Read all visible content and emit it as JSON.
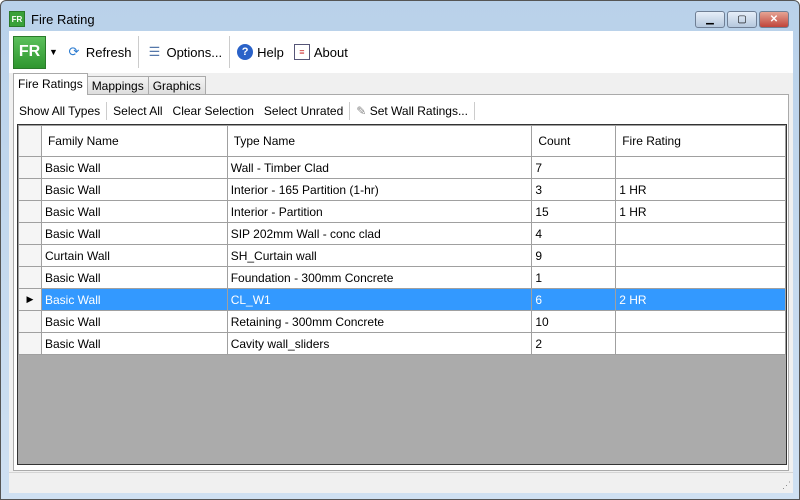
{
  "window": {
    "title": "Fire Rating",
    "app_icon": "FR"
  },
  "toolbar": {
    "logo": "FR",
    "refresh": "Refresh",
    "options": "Options...",
    "help": "Help",
    "about": "About"
  },
  "tabs": [
    "Fire Ratings",
    "Mappings",
    "Graphics"
  ],
  "subtoolbar": {
    "show_all": "Show All Types",
    "select_all": "Select All",
    "clear": "Clear Selection",
    "select_unrated": "Select Unrated",
    "set_ratings": "Set Wall Ratings..."
  },
  "grid": {
    "columns": [
      "Family Name",
      "Type Name",
      "Count",
      "Fire Rating"
    ],
    "rows": [
      [
        "Basic Wall",
        "Wall - Timber Clad",
        "7",
        ""
      ],
      [
        "Basic Wall",
        "Interior - 165 Partition (1-hr)",
        "3",
        "1 HR"
      ],
      [
        "Basic Wall",
        "Interior - Partition",
        "15",
        "1 HR"
      ],
      [
        "Basic Wall",
        "SIP 202mm Wall - conc clad",
        "4",
        ""
      ],
      [
        "Curtain Wall",
        "SH_Curtain wall",
        "9",
        ""
      ],
      [
        "Basic Wall",
        "Foundation - 300mm Concrete",
        "1",
        ""
      ],
      [
        "Basic Wall",
        "CL_W1",
        "6",
        "2 HR"
      ],
      [
        "Basic Wall",
        "Retaining - 300mm Concrete",
        "10",
        ""
      ],
      [
        "Basic Wall",
        "Cavity wall_sliders",
        "2",
        ""
      ]
    ],
    "selected_row": 6
  }
}
